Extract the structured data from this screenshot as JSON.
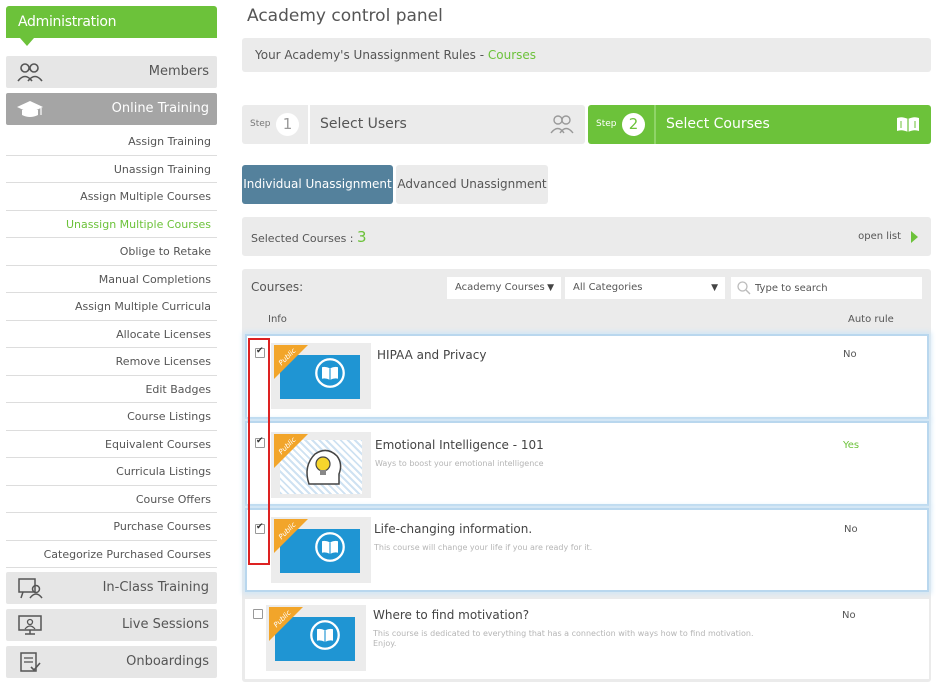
{
  "sidebar": {
    "header": "Administration",
    "categories": [
      {
        "label": "Members",
        "icon": "members-icon"
      },
      {
        "label": "Online Training",
        "icon": "graduation-cap-icon"
      },
      {
        "label": "In-Class Training",
        "icon": "classroom-icon"
      },
      {
        "label": "Live Sessions",
        "icon": "monitor-presenter-icon"
      },
      {
        "label": "Onboardings",
        "icon": "checklist-icon"
      }
    ],
    "sub_items": [
      "Assign Training",
      "Unassign Training",
      "Assign Multiple Courses",
      "Unassign Multiple Courses",
      "Oblige to Retake",
      "Manual Completions",
      "Assign Multiple Curricula",
      "Allocate Licenses",
      "Remove Licenses",
      "Edit Badges",
      "Course Listings",
      "Equivalent Courses",
      "Curricula Listings",
      "Course Offers",
      "Purchase Courses",
      "Categorize Purchased Courses"
    ],
    "current_sub_item": "Unassign Multiple Courses"
  },
  "main": {
    "title": "Academy control panel",
    "rules_prefix": "Your Academy's Unassignment Rules - ",
    "rules_link": "Courses",
    "steps": [
      {
        "word": "Step",
        "number": "1",
        "label": "Select Users",
        "icon": "users-icon"
      },
      {
        "word": "Step",
        "number": "2",
        "label": "Select Courses",
        "icon": "open-book-icon"
      }
    ],
    "tabs": [
      "Individual Unassignment",
      "Advanced Unassignment"
    ],
    "selected_label": "Selected Courses : ",
    "selected_count": "3",
    "open_list": "open list",
    "courses_label": "Courses:",
    "filter_academy": "Academy Courses",
    "filter_category": "All Categories",
    "search_placeholder": "Type to search",
    "col_info": "Info",
    "col_auto": "Auto rule",
    "badge_text": "Public",
    "courses": [
      {
        "title": "HIPAA and Privacy",
        "description": "",
        "auto": "No",
        "checked": true,
        "thumb": "book"
      },
      {
        "title": "Emotional Intelligence - 101",
        "description": "Ways to boost your emotional intelligence",
        "auto": "Yes",
        "checked": true,
        "thumb": "bulb"
      },
      {
        "title": "Life-changing information.",
        "description": "This course will change your life if you are ready for it.",
        "auto": "No",
        "checked": true,
        "thumb": "book"
      },
      {
        "title": "Where to find motivation?",
        "description": "This course is dedicated to everything that has a connection with ways how to find motivation. Enjoy.",
        "auto": "No",
        "checked": false,
        "thumb": "book"
      }
    ]
  },
  "colors": {
    "accent_green": "#6cc23a",
    "tab_blue": "#54819c",
    "course_blue": "#1f95d3",
    "badge_orange": "#f2a52a",
    "highlight_red": "#dd2222"
  }
}
